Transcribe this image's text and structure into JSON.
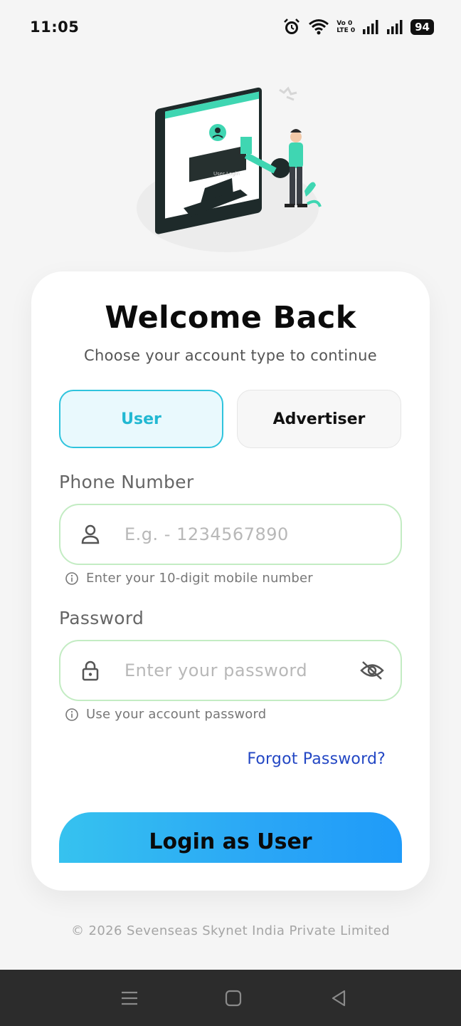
{
  "status_bar": {
    "time": "11:05",
    "volte_top": "Vo 0",
    "volte_bottom": "LTE 0",
    "battery": "94"
  },
  "header": {
    "title": "Welcome Back",
    "subtitle": "Choose your account type to continue"
  },
  "account_types": {
    "user_label": "User",
    "advertiser_label": "Advertiser",
    "selected": "User"
  },
  "phone": {
    "label": "Phone Number",
    "placeholder": "E.g. - 1234567890",
    "value": "",
    "hint": "Enter your 10-digit mobile number"
  },
  "password": {
    "label": "Password",
    "placeholder": "Enter your password",
    "value": "",
    "hint": "Use your account password"
  },
  "forgot_password": "Forgot Password?",
  "login_button": "Login as User",
  "footer": "© 2026 Sevenseas Skynet India Private Limited",
  "illustration_text": "User Login",
  "colors": {
    "accent": "#2fc4dd",
    "link": "#2347c4",
    "button_start": "#36c2ef",
    "button_end": "#1f9bf9",
    "input_border": "#c3ecc3"
  }
}
